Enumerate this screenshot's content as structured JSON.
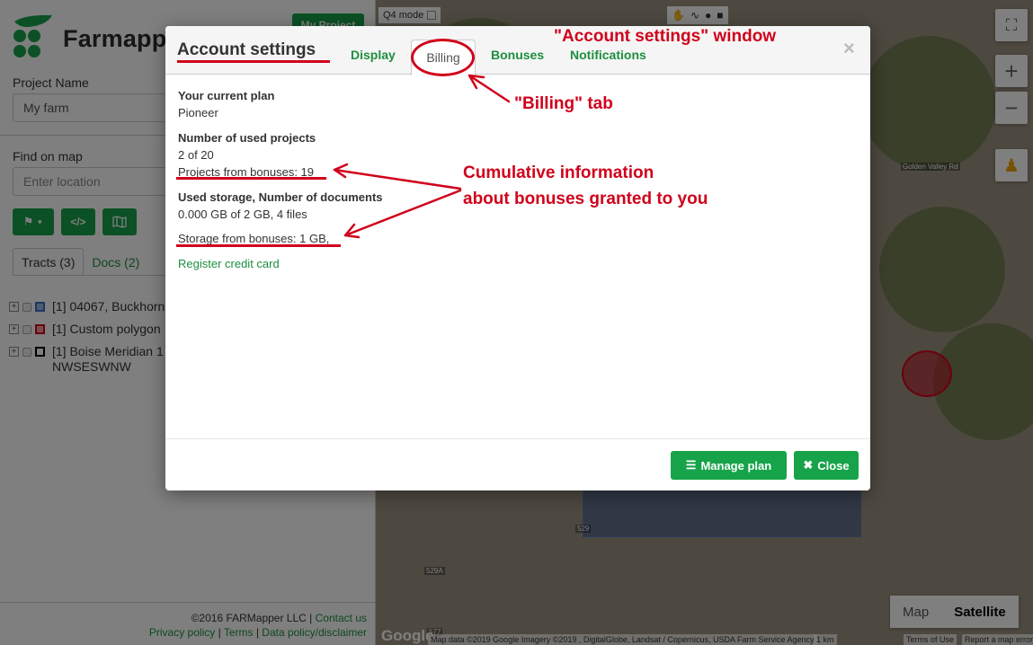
{
  "sidebar": {
    "logo_text": "Farmapper",
    "my_project_label": "My Project",
    "project_name_label": "Project Name",
    "project_name_value": "My farm",
    "find_on_map_label": "Find on map",
    "location_placeholder": "Enter location",
    "tabs": [
      {
        "label": "Tracts (3)"
      },
      {
        "label": "Docs (2)"
      }
    ],
    "tracts": [
      {
        "label": "[1] 04067, Buckhorn",
        "color": "#3a6fbf"
      },
      {
        "label": "[1] Custom polygon",
        "color": "#d0021b"
      },
      {
        "label": "[1] Boise Meridian 1",
        "label2": "NWSESWNW",
        "color": "#000000"
      }
    ],
    "footer": {
      "copyright": "©2016 FARMapper LLC",
      "contact": "Contact us",
      "privacy": "Privacy policy",
      "terms": "Terms",
      "data_policy": "Data policy/disclaimer"
    }
  },
  "map": {
    "q4_label": "Q4 mode",
    "road_label": "Golden Valley Rd",
    "route_529": "529",
    "route_529a": "529A",
    "route_577": "577",
    "google": "Google",
    "attribution": "Map data ©2019 Google Imagery ©2019 , DigitalGlobe, Landsat / Copernicus, USDA Farm Service Agency",
    "scale": "1 km",
    "terms": "Terms of Use",
    "report": "Report a map error",
    "map_label": "Map",
    "satellite_label": "Satellite"
  },
  "modal": {
    "title": "Account settings",
    "tabs": {
      "display": "Display",
      "billing": "Billing",
      "bonuses": "Bonuses",
      "notifications": "Notifications"
    },
    "close_symbol": "×",
    "plan_label": "Your current plan",
    "plan_value": "Pioneer",
    "projects_label": "Number of used projects",
    "projects_value": "2 of 20",
    "projects_bonus": "Projects from bonuses: 19",
    "storage_label": "Used storage, Number of documents",
    "storage_value": "0.000 GB of 2 GB, 4 files",
    "storage_bonus": "Storage from bonuses: 1 GB,",
    "register_card": "Register credit card",
    "manage_plan": "Manage plan",
    "close_label": "Close"
  },
  "annotations": {
    "window": "\"Account settings\" window",
    "billing_tab": "\"Billing\" tab",
    "bonuses_line1": "Cumulative information",
    "bonuses_line2": "about bonuses granted to you"
  }
}
